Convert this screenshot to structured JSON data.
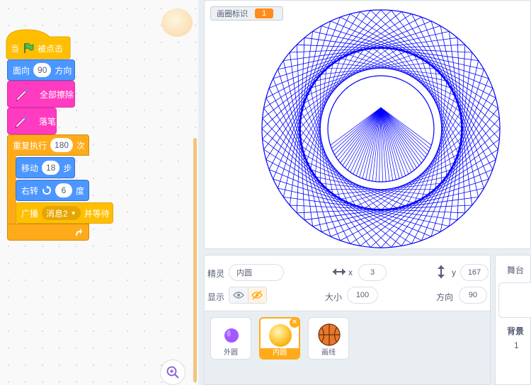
{
  "code": {
    "when_flag_clicked": {
      "prefix": "当",
      "suffix": "被点击"
    },
    "point_in_direction": {
      "prefix": "面向",
      "value": "90",
      "suffix": "方向"
    },
    "erase_all": {
      "label": "全部擦除"
    },
    "pen_down": {
      "label": "落笔"
    },
    "repeat": {
      "prefix": "重复执行",
      "value": "180",
      "suffix": "次"
    },
    "move": {
      "prefix": "移动",
      "value": "18",
      "suffix": "步"
    },
    "turn_right": {
      "prefix": "右转",
      "value": "6",
      "suffix": "度"
    },
    "broadcast": {
      "prefix": "广播",
      "message": "消息2",
      "suffix": "并等待"
    }
  },
  "stage": {
    "monitor": {
      "label": "画圈标识",
      "value": "1"
    }
  },
  "sprite_info": {
    "sprite_label": "精灵",
    "sprite_name": "内圆",
    "x_label": "x",
    "x_value": "3",
    "y_label": "y",
    "y_value": "167",
    "show_label": "显示",
    "size_label": "大小",
    "size_value": "100",
    "direction_label": "方向",
    "direction_value": "90"
  },
  "sprites": [
    {
      "name": "外圆",
      "selected": false
    },
    {
      "name": "内圆",
      "selected": true
    },
    {
      "name": "画线",
      "selected": false
    }
  ],
  "stage_panel": {
    "title": "舞台",
    "backdrops_label": "背景",
    "backdrops_count": "1"
  },
  "colors": {
    "pen": "#0000ff",
    "events": "#ffbf00",
    "motion": "#4c97ff",
    "pen_ext": "#ff3bc1",
    "control": "#ffab19"
  }
}
